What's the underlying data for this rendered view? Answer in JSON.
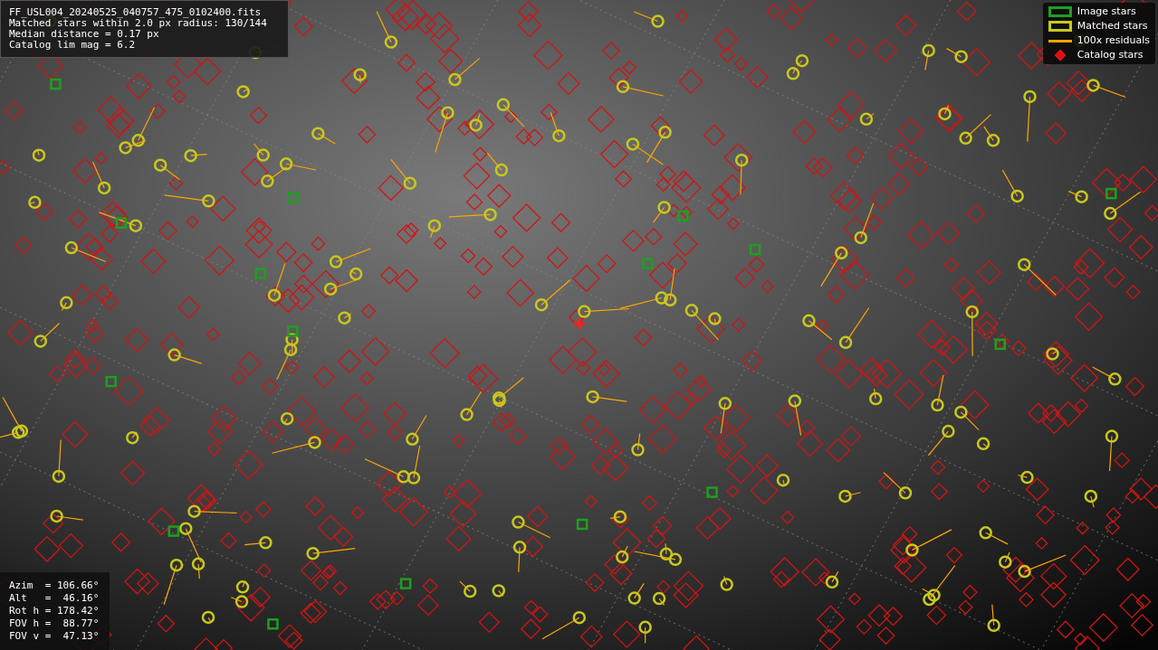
{
  "info_box": {
    "lines": [
      "FF_USL004_20240525_040757_475_0102400.fits",
      "Matched stars within 2.0 px radius: 130/144",
      "Median distance = 0.17 px",
      "Catalog lim mag = 6.2"
    ]
  },
  "legend": [
    {
      "kind": "box",
      "label": "Image stars",
      "color": "#1f9e1f"
    },
    {
      "kind": "box",
      "label": "Matched stars",
      "color": "#c8c81e"
    },
    {
      "kind": "line",
      "label": "100x residuals",
      "color": "#ffa500"
    },
    {
      "kind": "diamond",
      "label": "Catalog stars",
      "color": "#e01010"
    }
  ],
  "pointing_box": {
    "lines": [
      "Azim  = 106.66°",
      "Alt   =  46.16°",
      "Rot h = 178.42°",
      "FOV h =  88.77°",
      "FOV v =  47.13°"
    ]
  }
}
